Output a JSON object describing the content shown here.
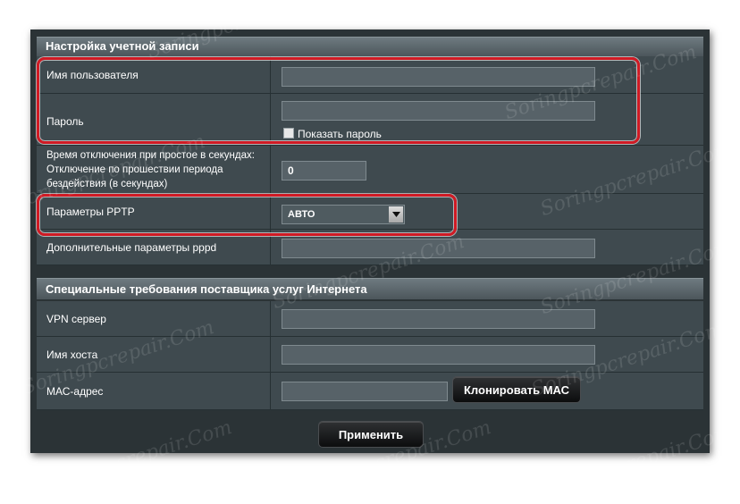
{
  "sections": {
    "account": {
      "title": "Настройка учетной записи",
      "username": {
        "label": "Имя пользователя",
        "value": ""
      },
      "password": {
        "label": "Пароль",
        "value": "",
        "show_label": "Показать пароль"
      },
      "idle": {
        "label": "Время отключения при простое в секундах: Отключение по прошествии периода бездействия (в секундах)",
        "value": "0"
      },
      "pptp": {
        "label": "Параметры PPTP",
        "selected": "АВТО"
      },
      "pppd": {
        "label": "Дополнительные параметры pppd",
        "value": ""
      }
    },
    "isp": {
      "title": "Специальные требования поставщика услуг Интернета",
      "vpn": {
        "label": "VPN сервер",
        "value": ""
      },
      "host": {
        "label": "Имя хоста",
        "value": ""
      },
      "mac": {
        "label": "МАС-адрес",
        "value": "",
        "clone_label": "Клонировать МАС"
      }
    }
  },
  "apply_label": "Применить",
  "watermark_text": "Soringpcrepair.Com",
  "colors": {
    "highlight": "#d01a24",
    "panel": "#3f4a4f",
    "header": "#5d686e"
  }
}
